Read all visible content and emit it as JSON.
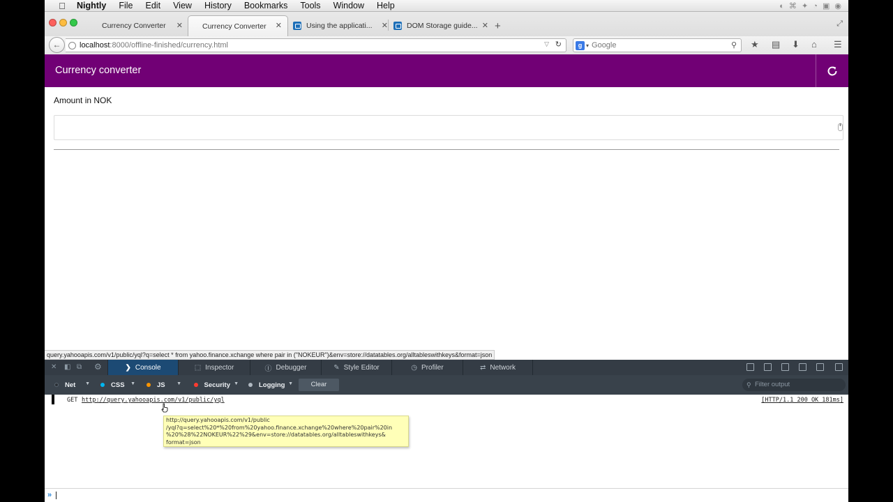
{
  "menubar": {
    "app": "Nightly",
    "items": [
      "File",
      "Edit",
      "View",
      "History",
      "Bookmarks",
      "Tools",
      "Window",
      "Help"
    ]
  },
  "tabs": [
    {
      "label": "Currency Converter",
      "active": false
    },
    {
      "label": "Currency Converter",
      "active": true
    },
    {
      "label": "Using the applicati...",
      "active": false
    },
    {
      "label": "DOM Storage guide...",
      "active": false
    }
  ],
  "urlbar": {
    "host": "localhost",
    "path": ":8000/offline-finished/currency.html"
  },
  "searchbar": {
    "placeholder": "Google"
  },
  "page": {
    "app_title": "Currency converter",
    "amount_label": "Amount in NOK",
    "amount_value": "",
    "accent_color": "#710075"
  },
  "status_bar": {
    "url": "query.yahooapis.com/v1/public/yql?q=select * from yahoo.finance.xchange where pair in (\"NOKEUR\")&env=store://datatables.org/alltableswithkeys&format=json"
  },
  "devtools": {
    "tabs": [
      "Console",
      "Inspector",
      "Debugger",
      "Style Editor",
      "Profiler",
      "Network"
    ],
    "active_tab": "Console",
    "filters": [
      {
        "label": "Net",
        "color": "#2a2f35"
      },
      {
        "label": "CSS",
        "color": "#00b6f0"
      },
      {
        "label": "JS",
        "color": "#fb9500"
      },
      {
        "label": "Security",
        "color": "#ff3b30"
      },
      {
        "label": "Logging",
        "color": "#b0b9c1"
      }
    ],
    "clear_label": "Clear",
    "filter_placeholder": "Filter output",
    "message": {
      "method": "GET",
      "url": "http://query.yahooapis.com/v1/public/yql",
      "status": "[HTTP/1.1 200 OK 181ms]"
    },
    "tooltip": "http://query.yahooapis.com/v1/public\n/yql?q=select%20*%20from%20yahoo.finance.xchange%20where%20pair%20in\n%20%28%22NOKEUR%22%29&env=store://datatables.org/alltableswithkeys&\nformat=json",
    "prompt": "»"
  }
}
